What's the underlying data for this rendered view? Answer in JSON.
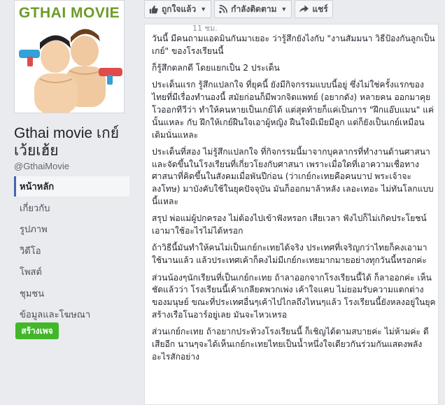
{
  "page": {
    "logo_text": "GTHAI MOVIE",
    "name": "Gthai movie เกย์เว้ยเฮ้ย",
    "handle": "@GthaiMovie"
  },
  "nav": {
    "items": [
      {
        "label": "หน้าหลัก",
        "active": true
      },
      {
        "label": "เกี่ยวกับ"
      },
      {
        "label": "รูปภาพ"
      },
      {
        "label": "วิดีโอ"
      },
      {
        "label": "โพสต์"
      },
      {
        "label": "ชุมชน"
      },
      {
        "label": "ข้อมูลและโฆษณา"
      }
    ],
    "create_button": "สร้างเพจ"
  },
  "actions": {
    "like": "ถูกใจแล้ว",
    "follow": "กำลังติดตาม",
    "share": "แชร์"
  },
  "post": {
    "time": "11 ชม.",
    "paragraphs": [
      "วันนี้ มีคนถามแอดมินกันมาเยอะ ว่ารู้สึกยังไงกับ \"งานสัมมนา วิธีป้องกันลูกเป็นเกย์\" ของโรงเรียนนี้",
      "ก็รู้สึกตลกดี โดยแยกเป็น 2 ประเด็น",
      "ประเด็นแรก รู้สึกแปลกใจ ที่ยุคนี้ ยังมีกิจกรรมแบบนี้อยู่ ซึ่งไม่ใช่ครั้งแรกของไทยที่มีเรื่องทำนองนี้ สมัยก่อนก็มีพวกจิตแพทย์ (อยากดัง) หลายคน ออกมาคุยโวออกทีวีว่า ทำให้คนหายเป็นเกย์ได้ แต่สุดท้ายก็แค่เป็นการ \"ฝึกแอ๊บแมน\" แค่นั้นแหละ กับ ฝึกให้เกย์ฝืนใจเอาผู้หญิง ฝืนใจมีเมียมีลูก แต่ก็ยังเป็นเกย์เหมือนเดิมนั่นแหละ",
      "ประเด็นที่สอง ไม่รู้สึกแปลกใจ ที่กิจกรรมนี้มาจากบุคลากรที่ทำงานด้านศาสนา และจัดขึ้นในโรงเรียนที่เกี่ยวโยงกับศาสนา เพราะเมื่อใดที่เอาความเชื่อทางศาสนาที่คิดขึ้นในสังคมเมื่อพันปีก่อน (ว่าเกย์กะเทยคือคนบาป พระเจ้าจะลงโทษ) มาบังคับใช้ในยุคปัจจุบัน มันก็ออกมาล้าหลัง เลอะเทอะ ไม่ทันโลกแบบนี้แหละ",
      "สรุป พ่อแม่ผู้ปกครอง ไม่ต้องไปเข้าฟังหรอก เสียเวลา ฟังไปก็ไม่เกิดประโยชน์ เอามาใช้อะไรไม่ได้หรอก",
      "ถ้าวิธีนี้มันทำให้คนไม่เป็นเกย์กะเทยได้จริง ประเทศที่เจริญกว่าไทยก็คงเอามาใช้นานแล้ว แล้วประเทศเค้าก็คงไม่มีเกย์กะเทยมากมายอย่างทุกวันนี้หรอกค่ะ",
      "ส่วนน้องๆนักเรียนที่เป็นเกย์กะเทย ถ้าลาออกจากโรงเรียนนี้ได้ ก็ลาออกค่ะ เห็นชัดแล้วว่า โรงเรียนนี้เค้าเกลียดพวกเพ่ง เค้าใจแคบ ไม่ยอมรับความแตกต่างของมนุษย์ ขณะที่ประเทศอื่นๆเค้าไปไกลถึงไหนๆแล้ว โรงเรียนนี้ยังหลงอยู่ในยุคสร้างเรือโนอาร์อยู่เลย มันจะไหวเหรอ",
      "ส่วนเกย์กะเทย ถ้าอยากประท้วงโรงเรียนนี้ ก็เชิญได้ตามสบายค่ะ ไม่ห้ามค่ะ ดีเสียอีก นานๆจะได้เห็นเกย์กะเทยไทยเป็นน้ำหนึ่งใจเดียวกันร่วมกันแสดงพลังอะไรสักอย่าง"
    ]
  },
  "colors": {
    "fb_blue": "#4267b2",
    "create_green": "#42b72a",
    "logo_green": "#6c9b27",
    "page_bg": "#e9ebee"
  }
}
